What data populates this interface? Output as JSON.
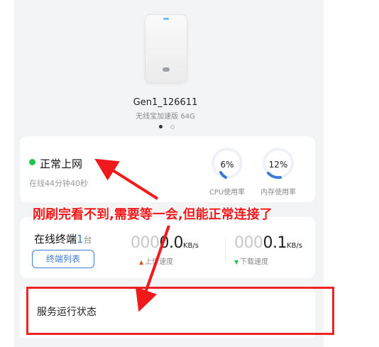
{
  "device": {
    "name": "Gen1_126611",
    "model": "无线宝加速版 64G"
  },
  "status": {
    "text": "正常上网",
    "online_time": "在线44分钟40秒",
    "color": "#27c24c"
  },
  "gauges": {
    "cpu": {
      "value": "6%",
      "fraction": 0.06,
      "label": "CPU使用率"
    },
    "mem": {
      "value": "12%",
      "fraction": 0.12,
      "label": "内存使用率"
    }
  },
  "terminals": {
    "label": "在线终端",
    "count": "1",
    "unit": "台",
    "button": "终端列表"
  },
  "speed": {
    "up_prefix": "000",
    "up_value": "0.0",
    "up_unit": "KB/s",
    "up_label": "上传速度",
    "down_prefix": "000",
    "down_value": "0.1",
    "down_unit": "KB/s",
    "down_label": "下载速度"
  },
  "service": {
    "title": "服务运行状态"
  },
  "annotation": {
    "text": "刚刷完看不到,需要等一会,但能正常连接了",
    "color": "#f0191b"
  },
  "pager": {
    "active_index": 0,
    "count": 2
  },
  "accent": "#3a7bd5"
}
